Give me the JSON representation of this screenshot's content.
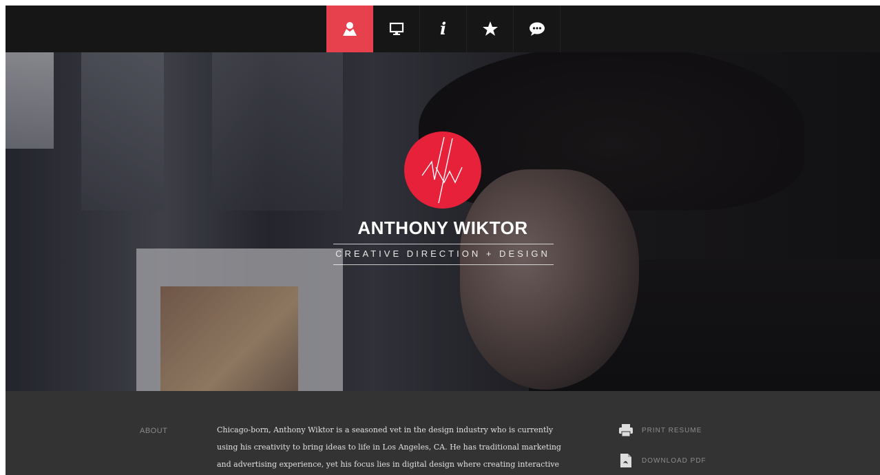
{
  "nav": {
    "items": [
      {
        "icon": "user-icon",
        "active": true
      },
      {
        "icon": "monitor-icon",
        "active": false
      },
      {
        "icon": "info-icon",
        "glyph": "i",
        "active": false
      },
      {
        "icon": "star-icon",
        "active": false
      },
      {
        "icon": "chat-icon",
        "active": false
      }
    ],
    "accent_color": "#e8414e"
  },
  "hero": {
    "name": "ANTHONY WIKTOR",
    "tagline": "CREATIVE DIRECTION + DESIGN",
    "logo_color": "#e8213b"
  },
  "about": {
    "label": "ABOUT",
    "lines": [
      "Chicago-born, Anthony Wiktor is a seasoned vet in the design industry who is currently",
      "using his creativity to bring ideas to life in Los Angeles, CA. He has traditional marketing",
      "and advertising experience, yet his focus lies in digital design where creating interactive"
    ]
  },
  "actions": {
    "print_label": "PRINT RESUME",
    "download_label": "DOWNLOAD PDF"
  }
}
